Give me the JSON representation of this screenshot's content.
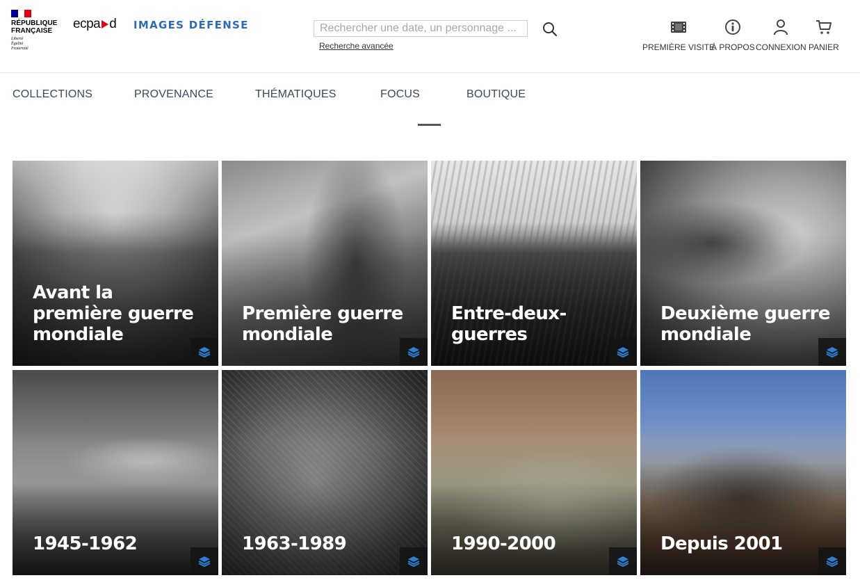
{
  "brand": {
    "rf_line1": "RÉPUBLIQUE",
    "rf_line2": "FRANÇAISE",
    "rf_motto1": "Liberté",
    "rf_motto2": "Égalité",
    "rf_motto3": "Fraternité",
    "ecpad_left": "ecpa",
    "ecpad_right": "d",
    "images_defense": "IMAGES DÉFENSE"
  },
  "search": {
    "placeholder": "Rechercher une date, un personnage ...",
    "advanced_label": "Recherche avancée"
  },
  "top_nav": [
    {
      "label": "PREMIÈRE VISITE",
      "icon": "film-icon"
    },
    {
      "label": "À PROPOS",
      "icon": "info-icon"
    },
    {
      "label": "CONNEXION",
      "icon": "user-icon"
    },
    {
      "label": "PANIER",
      "icon": "cart-icon"
    }
  ],
  "main_nav": [
    {
      "label": "COLLECTIONS"
    },
    {
      "label": "PROVENANCE"
    },
    {
      "label": "THÉMATIQUES"
    },
    {
      "label": "FOCUS"
    },
    {
      "label": "BOUTIQUE"
    }
  ],
  "tiles": [
    {
      "title": "Avant la première guerre mondiale",
      "icon": "layers-icon"
    },
    {
      "title": "Première guerre mondiale",
      "icon": "layers-icon"
    },
    {
      "title": "Entre-deux-guerres",
      "icon": "layers-icon"
    },
    {
      "title": "Deuxième guerre mondiale",
      "icon": "layers-icon"
    },
    {
      "title": "1945-1962",
      "icon": "layers-icon"
    },
    {
      "title": "1963-1989",
      "icon": "layers-icon"
    },
    {
      "title": "1990-2000",
      "icon": "layers-icon"
    },
    {
      "title": "Depuis 2001",
      "icon": "layers-icon"
    }
  ],
  "colors": {
    "accent_blue": "#2c6bb5",
    "badge_icon_blue": "#2f7fd0",
    "flag_blue": "#000091",
    "flag_red": "#e1000f",
    "ecpad_red": "#e2001a"
  }
}
